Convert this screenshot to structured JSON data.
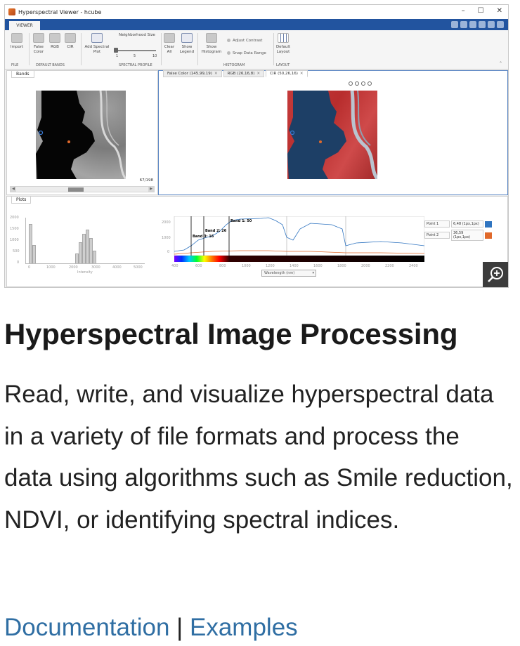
{
  "window": {
    "title": "Hyperspectral Viewer - hcube",
    "controls": [
      "–",
      "☐",
      "✕"
    ]
  },
  "toolstrip": {
    "tab_label": "VIEWER",
    "file": {
      "label": "FILE",
      "import_label": "Import"
    },
    "default_bands": {
      "label": "DEFAULT BANDS",
      "false_color_label": "False Color",
      "rgb_label": "RGB",
      "cir_label": "CIR"
    },
    "spectral_profile": {
      "label": "SPECTRAL PROFILE",
      "add_plot_label": "Add Spectral Plot",
      "neighborhood_label": "Neighborhood Size",
      "ticks": [
        "1",
        "5",
        "10"
      ]
    },
    "clear_all_label": "Clear All",
    "show_legend_label": "Show Legend",
    "histogram": {
      "label": "HISTOGRAM",
      "show_label": "Show Histogram",
      "adjust_contrast_label": "Adjust Contrast",
      "snap_range_label": "Snap Data Range"
    },
    "layout": {
      "label": "LAYOUT",
      "default_label": "Default Layout"
    }
  },
  "bands_panel": {
    "tab_label": "Bands",
    "band_counter": "67/198"
  },
  "image_tabs": [
    {
      "label": "False Color (145,99,19)"
    },
    {
      "label": "RGB (26,16,8)"
    },
    {
      "label": "CIR (50,26,16)"
    }
  ],
  "plots_panel": {
    "tab_label": "Plots",
    "histogram_xlabel": "Intensity",
    "histogram_xticks": [
      "0",
      "1000",
      "2000",
      "3000",
      "4000",
      "5000"
    ],
    "histogram_yticks": [
      "2000",
      "1500",
      "1000",
      "500",
      "0"
    ],
    "spectral_yticks": [
      "2000",
      "1000",
      "0"
    ],
    "spectral_xticks": [
      "400",
      "600",
      "800",
      "1000",
      "1200",
      "1400",
      "1600",
      "1800",
      "2000",
      "2200",
      "2400"
    ],
    "band_markers": [
      "Band 1: 50",
      "Band 2: 26",
      "Band 3: 16"
    ],
    "xaxis_dropdown": "Wavelength (nm)",
    "points": [
      {
        "name": "Point 1",
        "value": "6,48 (1px,1px)",
        "color": "#2f74c0"
      },
      {
        "name": "Point 2",
        "value": "36,59 (1px,1px)",
        "color": "#e0692b"
      }
    ]
  },
  "article": {
    "title": "Hyperspectral Image Processing",
    "description": "Read, write, and visualize hyperspectral data in a variety of file formats and process the data using algorithms such as Smile reduction, NDVI, or identifying spectral indices.",
    "documentation_link": "Documentation",
    "separator": "|",
    "examples_link": "Examples"
  }
}
